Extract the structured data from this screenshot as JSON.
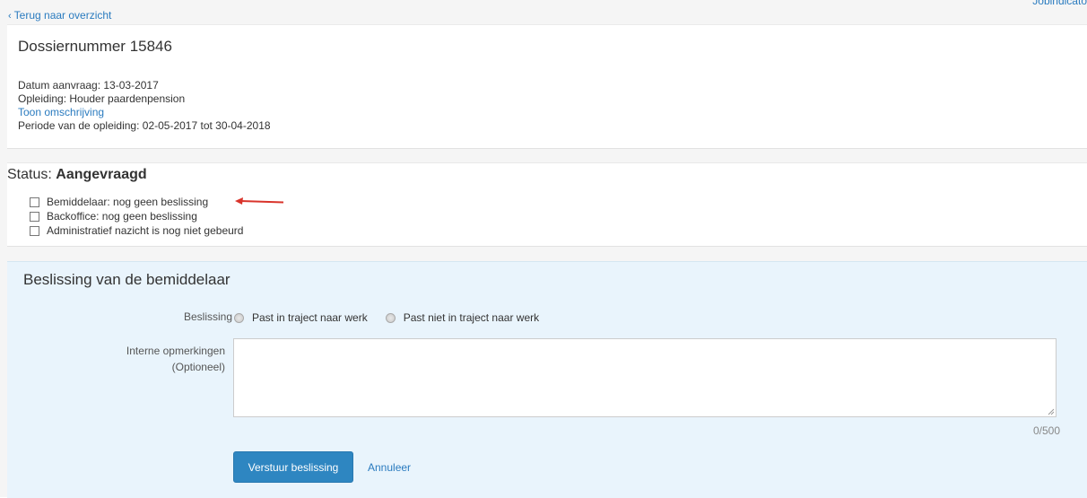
{
  "nav": {
    "back_arrow": "‹",
    "back_label": "Terug naar overzicht",
    "corner_link": "Jobindicato"
  },
  "dossier": {
    "title": "Dossiernummer 15846",
    "datum_aanvraag": "Datum aanvraag: 13-03-2017",
    "opleiding": "Opleiding: Houder paardenpension",
    "toon_omschrijving": "Toon omschrijving",
    "periode": "Periode van de opleiding: 02-05-2017 tot 30-04-2018"
  },
  "status": {
    "label": "Status:",
    "value": "Aangevraagd",
    "items": [
      {
        "label": "Bemiddelaar: nog geen beslissing",
        "checked": false
      },
      {
        "label": "Backoffice: nog geen beslissing",
        "checked": false
      },
      {
        "label": "Administratief nazicht is nog niet gebeurd",
        "checked": false
      }
    ],
    "arrow_color": "#d9342b"
  },
  "decision": {
    "title": "Beslissing van de bemiddelaar",
    "beslissing_label": "Beslissing",
    "options": [
      "Past in traject naar werk",
      "Past niet in traject naar werk"
    ],
    "comments_label_line1": "Interne opmerkingen",
    "comments_label_line2": "(Optioneel)",
    "comments_value": "",
    "counter": "0/500",
    "submit_label": "Verstuur beslissing",
    "cancel_label": "Annuleer"
  },
  "colors": {
    "link": "#2a7bbf",
    "primary_button": "#2e86c1",
    "panel_bg": "#e9f4fc",
    "page_bg": "#f5f5f5"
  }
}
